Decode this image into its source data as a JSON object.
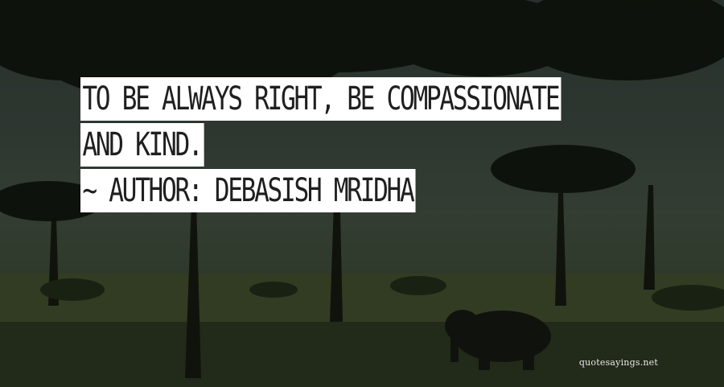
{
  "quote": {
    "line1": "TO BE ALWAYS RIGHT, BE COMPASSIONATE",
    "line2": "AND KIND.",
    "author_line": "~ AUTHOR: DEBASISH MRIDHA"
  },
  "watermark": "quotesayings.net",
  "colors": {
    "highlight": "#ffffff",
    "text": "#1f1f1f"
  }
}
